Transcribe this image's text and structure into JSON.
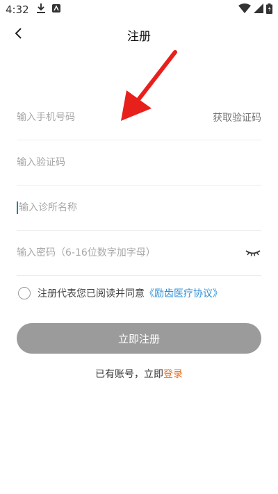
{
  "status_bar": {
    "time": "4:32"
  },
  "header": {
    "title": "注册"
  },
  "form": {
    "phone": {
      "placeholder": "输入手机号码",
      "action_label": "获取验证码"
    },
    "code": {
      "placeholder": "输入验证码"
    },
    "clinic": {
      "placeholder": "输入诊所名称"
    },
    "password": {
      "placeholder": "输入密码（6-16位数字加字母）"
    }
  },
  "agreement": {
    "text": "注册代表您已阅读并同意",
    "link_label": "《励齿医疗协议》"
  },
  "submit": {
    "label": "立即注册"
  },
  "login": {
    "text": "已有账号，立即",
    "link_label": "登录"
  },
  "colors": {
    "link_blue": "#2f8fd8",
    "login_orange": "#e8712b",
    "button_gray": "#9b9b9b",
    "annotation_red": "#e8201c"
  },
  "icons": [
    "back-icon",
    "download-icon",
    "notification-icon",
    "wifi-icon",
    "signal-icon",
    "battery-icon",
    "eye-closed-icon"
  ]
}
